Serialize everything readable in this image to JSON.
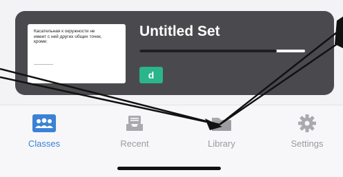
{
  "set_card": {
    "thumbnail_text": "Касательная к окружности не имеет с ней других общих точек, кроме:",
    "title": "Untitled Set",
    "progress_fraction": 0.83,
    "badge_label": "d",
    "colors": {
      "card_bg": "#4a4a4e",
      "badge_bg": "#2ab58a",
      "active_tab": "#3b82d6",
      "inactive_tab": "#9a9aa0"
    }
  },
  "tabs": [
    {
      "label": "Classes",
      "icon": "classes-icon",
      "active": true
    },
    {
      "label": "Recent",
      "icon": "inbox-tray-icon",
      "active": false
    },
    {
      "label": "Library",
      "icon": "folder-icon",
      "active": false
    },
    {
      "label": "Settings",
      "icon": "gear-icon",
      "active": false
    }
  ]
}
